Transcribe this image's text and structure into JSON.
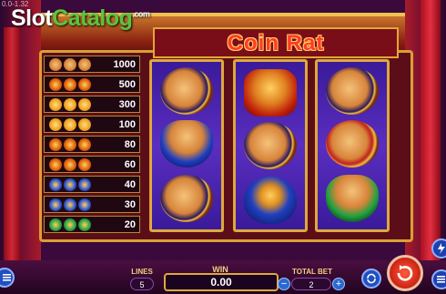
{
  "watermark": {
    "slot": "Slot",
    "catalog": "Catalog",
    "com": ".com"
  },
  "version": "0.0-1.32",
  "game_logo": "Coin Rat",
  "paytable": [
    {
      "icon": "rat-coin",
      "value": "1000"
    },
    {
      "icon": "red-coin",
      "value": "500"
    },
    {
      "icon": "orange-coin",
      "value": "300"
    },
    {
      "icon": "orange-knot",
      "value": "100"
    },
    {
      "icon": "red-lantern",
      "value": "80"
    },
    {
      "icon": "red-ornament",
      "value": "60"
    },
    {
      "icon": "blue-bag",
      "value": "40"
    },
    {
      "icon": "blue-bag-small",
      "value": "30"
    },
    {
      "icon": "green-bag",
      "value": "20"
    }
  ],
  "reels": [
    [
      "rat-coin-symbol",
      "rat-blue-bag-symbol",
      "rat-coin-symbol"
    ],
    [
      "golden-bells-symbol",
      "rat-coin-symbol",
      "blue-bag-symbol"
    ],
    [
      "rat-coin-symbol",
      "rat-coin-red-symbol",
      "rat-green-bag-symbol"
    ]
  ],
  "controls": {
    "lines_label": "LINES",
    "lines_value": "5",
    "win_label": "WIN",
    "win_value": "0.00",
    "total_bet_label": "TOTAL BET",
    "total_bet_value": "2",
    "minus_symbol": "−",
    "plus_symbol": "+",
    "spin_icon": "spin-arrow-icon",
    "menu_icon": "menu-icon",
    "autoplay_icon": "autoplay-icon",
    "turbo_icon": "turbo-icon"
  },
  "colors": {
    "frame_gold": "#e0a83a",
    "reel_purple": "#4a22b0",
    "spin_red": "#d42a1a",
    "logo_red": "#ff3a2a"
  }
}
